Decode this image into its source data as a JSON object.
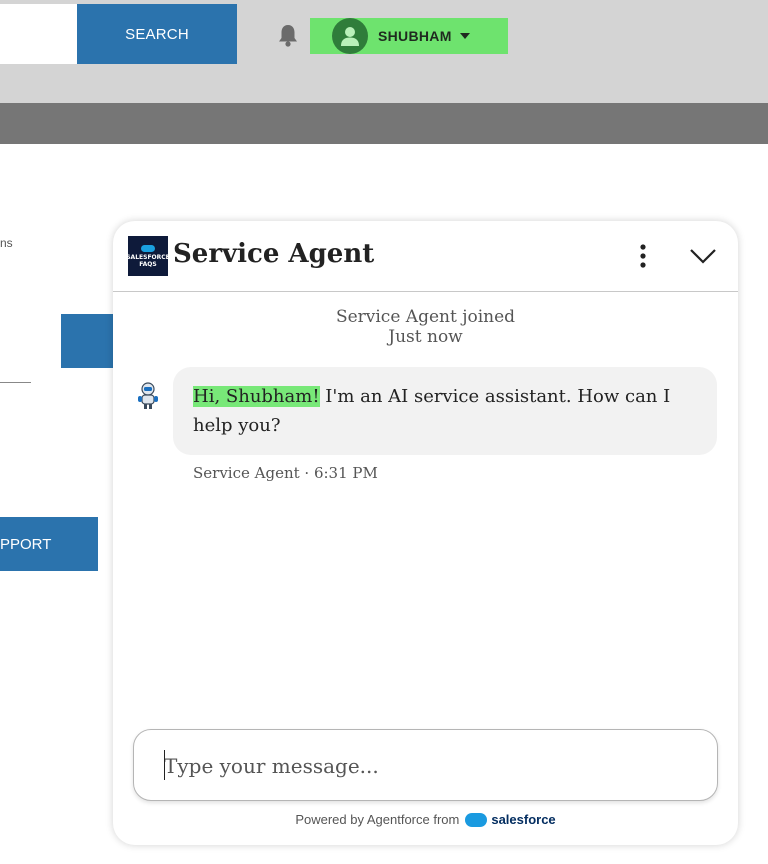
{
  "header": {
    "search_placeholder": "",
    "search_button": "SEARCH",
    "user_name": "SHUBHAM"
  },
  "page": {
    "fragment_text": "ns",
    "support_button": "PPORT"
  },
  "chat": {
    "title": "Service Agent",
    "logo_lines": [
      "SALESFORCE",
      "FAQS"
    ],
    "joined_text": "Service Agent joined",
    "joined_time": "Just now",
    "message": {
      "highlighted": "Hi, Shubham!",
      "rest": " I'm an AI service assistant. How can I help you?",
      "meta": "Service Agent · 6:31 PM"
    },
    "composer_placeholder": "Type your message...",
    "powered_prefix": "Powered by Agentforce from",
    "powered_brand": "salesforce"
  },
  "colors": {
    "accent_blue": "#2b73ad",
    "user_menu_green": "#6ee36e",
    "highlight_green": "#78e878",
    "topbar_gray": "#d4d4d4",
    "band_gray": "#767676"
  },
  "icons": {
    "bell": "bell-icon",
    "user": "user-icon",
    "menu": "kebab-menu-icon",
    "collapse": "chevron-down-icon",
    "bot": "robot-icon"
  }
}
